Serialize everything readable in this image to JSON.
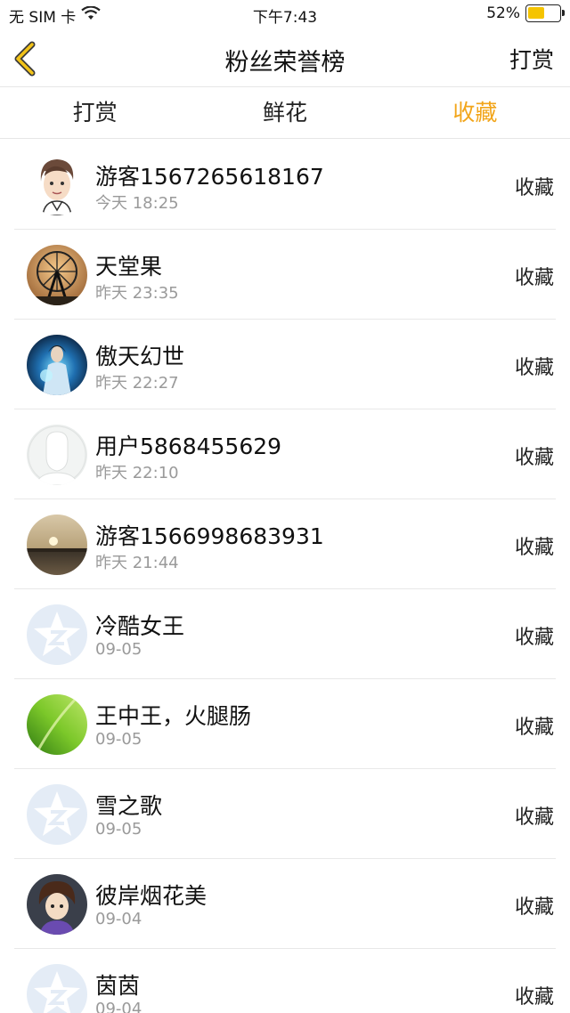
{
  "status_bar": {
    "carrier": "无 SIM 卡",
    "wifi_icon": "wifi-icon",
    "time": "下午7:43",
    "battery_percent": "52%",
    "battery_level": 0.52,
    "battery_color": "#f5c400"
  },
  "nav": {
    "back_icon": "chevron-left-icon",
    "title": "粉丝荣誉榜",
    "right_action": "打赏"
  },
  "tabs": [
    {
      "label": "打赏",
      "active": false
    },
    {
      "label": "鲜花",
      "active": false
    },
    {
      "label": "收藏",
      "active": true
    }
  ],
  "accent_color": "#f2a51a",
  "fans": [
    {
      "name": "游客1567265618167",
      "time": "今天 18:25",
      "action": "收藏",
      "avatar": "cartoon-man-avatar"
    },
    {
      "name": "天堂果",
      "time": "昨天 23:35",
      "action": "收藏",
      "avatar": "ferris-wheel-avatar"
    },
    {
      "name": "傲天幻世",
      "time": "昨天 22:27",
      "action": "收藏",
      "avatar": "fantasy-warrior-avatar"
    },
    {
      "name": "用户5868455629",
      "time": "昨天 22:10",
      "action": "收藏",
      "avatar": "default-user-avatar"
    },
    {
      "name": "游客1566998683931",
      "time": "昨天 21:44",
      "action": "收藏",
      "avatar": "sunset-lake-avatar"
    },
    {
      "name": "冷酷女王",
      "time": "09-05",
      "action": "收藏",
      "avatar": "qzone-star-avatar"
    },
    {
      "name": "王中王，火腿肠",
      "time": "09-05",
      "action": "收藏",
      "avatar": "green-leaf-avatar"
    },
    {
      "name": "雪之歌",
      "time": "09-05",
      "action": "收藏",
      "avatar": "qzone-star-avatar"
    },
    {
      "name": "彼岸烟花美",
      "time": "09-04",
      "action": "收藏",
      "avatar": "anime-boy-avatar"
    },
    {
      "name": "茵茵",
      "time": "09-04",
      "action": "收藏",
      "avatar": "qzone-star-avatar"
    }
  ]
}
